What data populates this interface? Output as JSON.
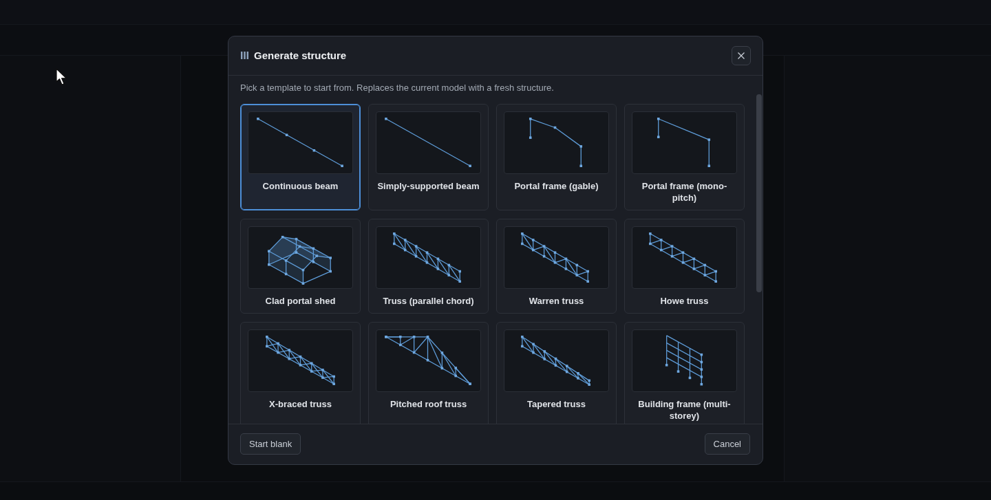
{
  "dialog": {
    "title": "Generate structure",
    "description": "Pick a template to start from. Replaces the current model with a fresh structure.",
    "templates": [
      {
        "label": "Continuous beam",
        "kind": "continuous-beam",
        "selected": true
      },
      {
        "label": "Simply-supported beam",
        "kind": "simple-beam",
        "selected": false
      },
      {
        "label": "Portal frame (gable)",
        "kind": "gable-frame",
        "selected": false
      },
      {
        "label": "Portal frame (mono-pitch)",
        "kind": "mono-pitch-frame",
        "selected": false
      },
      {
        "label": "Clad portal shed",
        "kind": "clad-shed",
        "selected": false
      },
      {
        "label": "Truss (parallel chord)",
        "kind": "parallel-truss",
        "selected": false
      },
      {
        "label": "Warren truss",
        "kind": "warren-truss",
        "selected": false
      },
      {
        "label": "Howe truss",
        "kind": "howe-truss",
        "selected": false
      },
      {
        "label": "X-braced truss",
        "kind": "x-braced-truss",
        "selected": false
      },
      {
        "label": "Pitched roof truss",
        "kind": "pitched-truss",
        "selected": false
      },
      {
        "label": "Tapered truss",
        "kind": "tapered-truss",
        "selected": false
      },
      {
        "label": "Building frame (multi-storey)",
        "kind": "multi-storey-frame",
        "selected": false
      }
    ],
    "footer": {
      "start_blank": "Start blank",
      "cancel": "Cancel"
    }
  }
}
